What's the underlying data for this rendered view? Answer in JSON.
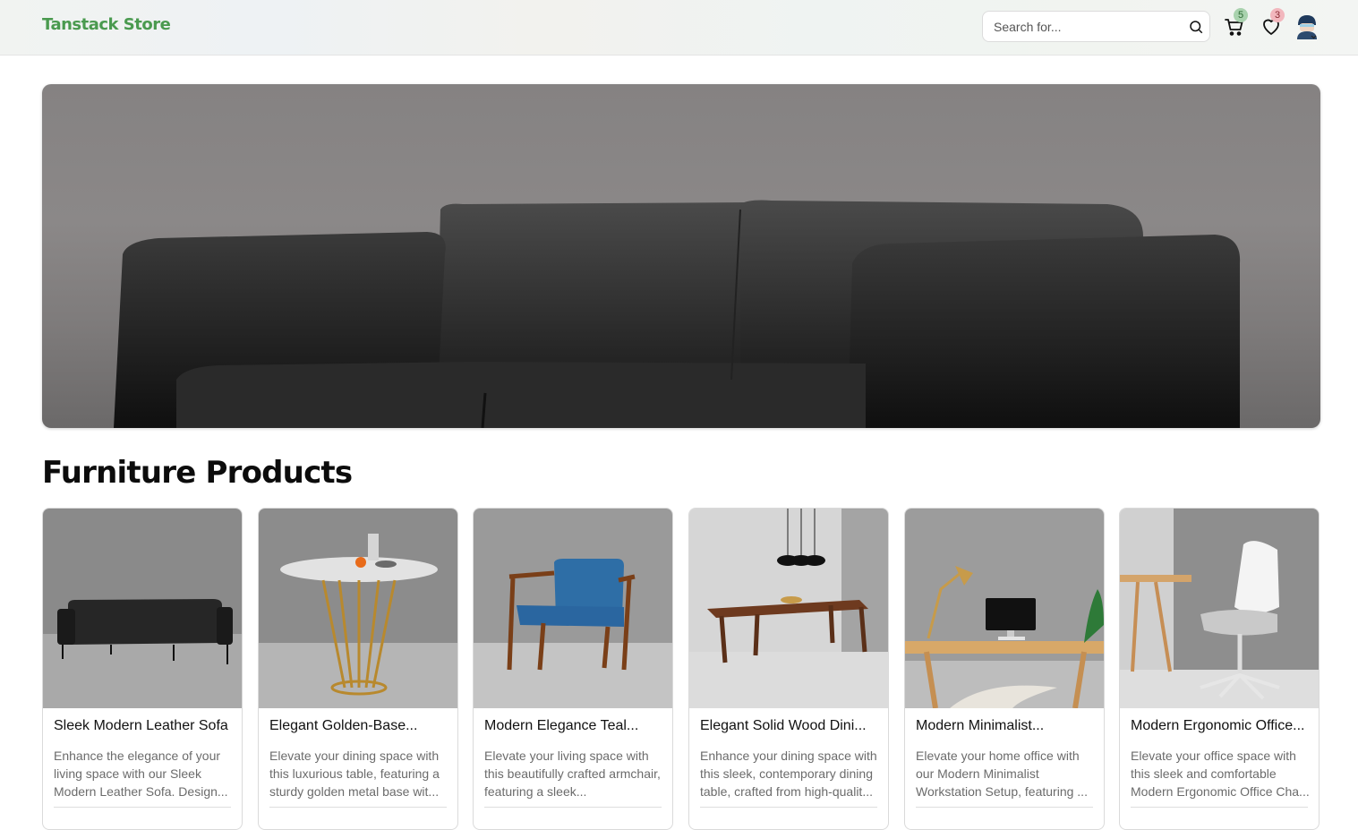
{
  "header": {
    "brand": "Tanstack Store",
    "search_placeholder": "Search for...",
    "cart_count": "5",
    "wishlist_count": "3"
  },
  "main": {
    "section_title": "Furniture Products",
    "products": [
      {
        "title": "Sleek Modern Leather Sofa",
        "description": "Enhance the elegance of your living space with our Sleek Modern Leather Sofa. Design..."
      },
      {
        "title": "Elegant Golden-Base...",
        "description": "Elevate your dining space with this luxurious table, featuring a sturdy golden metal base wit..."
      },
      {
        "title": "Modern Elegance Teal...",
        "description": "Elevate your living space with this beautifully crafted armchair, featuring a sleek..."
      },
      {
        "title": "Elegant Solid Wood Dini...",
        "description": "Enhance your dining space with this sleek, contemporary dining table, crafted from high-qualit..."
      },
      {
        "title": "Modern Minimalist...",
        "description": "Elevate your home office with our Modern Minimalist Workstation Setup, featuring ..."
      },
      {
        "title": "Modern Ergonomic Office...",
        "description": "Elevate your office space with this sleek and comfortable Modern Ergonomic Office Cha..."
      }
    ]
  },
  "colors": {
    "brand": "#4a9a4f",
    "cart_badge": "#a9d2ae",
    "wishlist_badge": "#f2b7bd"
  },
  "icons": [
    "search-icon",
    "cart-icon",
    "heart-icon",
    "user-avatar"
  ]
}
